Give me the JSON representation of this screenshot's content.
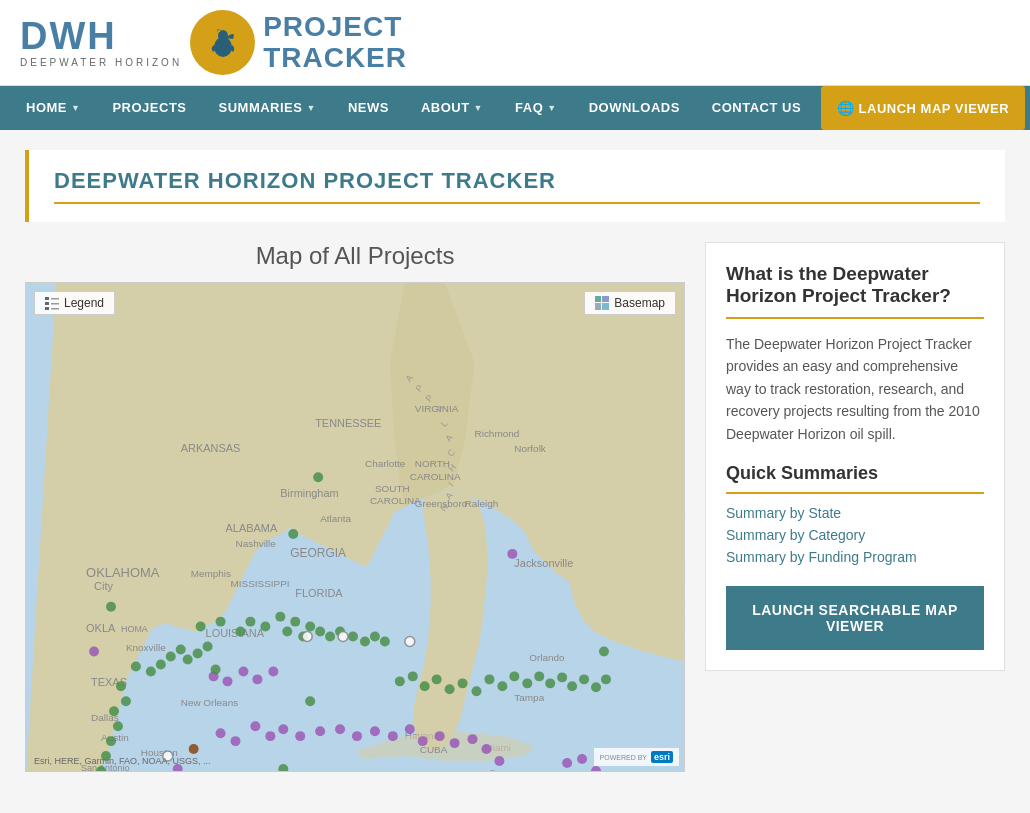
{
  "site": {
    "logo_dwh": "DWH",
    "logo_sub": "DEEPWATER HORIZON",
    "logo_project": "PROJECT",
    "logo_tracker": "TRACKER"
  },
  "nav": {
    "items": [
      {
        "label": "HOME",
        "has_arrow": true,
        "active": true
      },
      {
        "label": "PROJECTS",
        "has_arrow": false
      },
      {
        "label": "SUMMARIES",
        "has_arrow": true
      },
      {
        "label": "NEWS",
        "has_arrow": false
      },
      {
        "label": "ABOUT",
        "has_arrow": true
      },
      {
        "label": "FAQ",
        "has_arrow": true
      },
      {
        "label": "DOWNLOADS",
        "has_arrow": false
      },
      {
        "label": "CONTACT US",
        "has_arrow": false
      }
    ],
    "launch_label": "LAUNCH MAP VIEWER"
  },
  "page_title": "DEEPWATER HORIZON PROJECT TRACKER",
  "map": {
    "title": "Map of All Projects",
    "legend_btn": "Legend",
    "basemap_btn": "Basemap",
    "copyright": "Esri, HERE, Garmin, FAO, NOAA, USGS, ...",
    "powered_by": "POWERED BY",
    "esri": "esri"
  },
  "sidebar": {
    "what_title": "What is the Deepwater Horizon Project Tracker?",
    "description": "The Deepwater Horizon Project Tracker provides an easy and comprehensive way to track restoration, research, and recovery projects resulting from the 2010 Deepwater Horizon oil spill.",
    "quick_title": "Quick Summaries",
    "summary_links": [
      {
        "label": "Summary by State",
        "href": "#"
      },
      {
        "label": "Summary by Category",
        "href": "#"
      },
      {
        "label": "Summary by Funding Program",
        "href": "#"
      }
    ],
    "launch_btn": "LAUNCH SEARCHABLE MAP VIEWER"
  }
}
